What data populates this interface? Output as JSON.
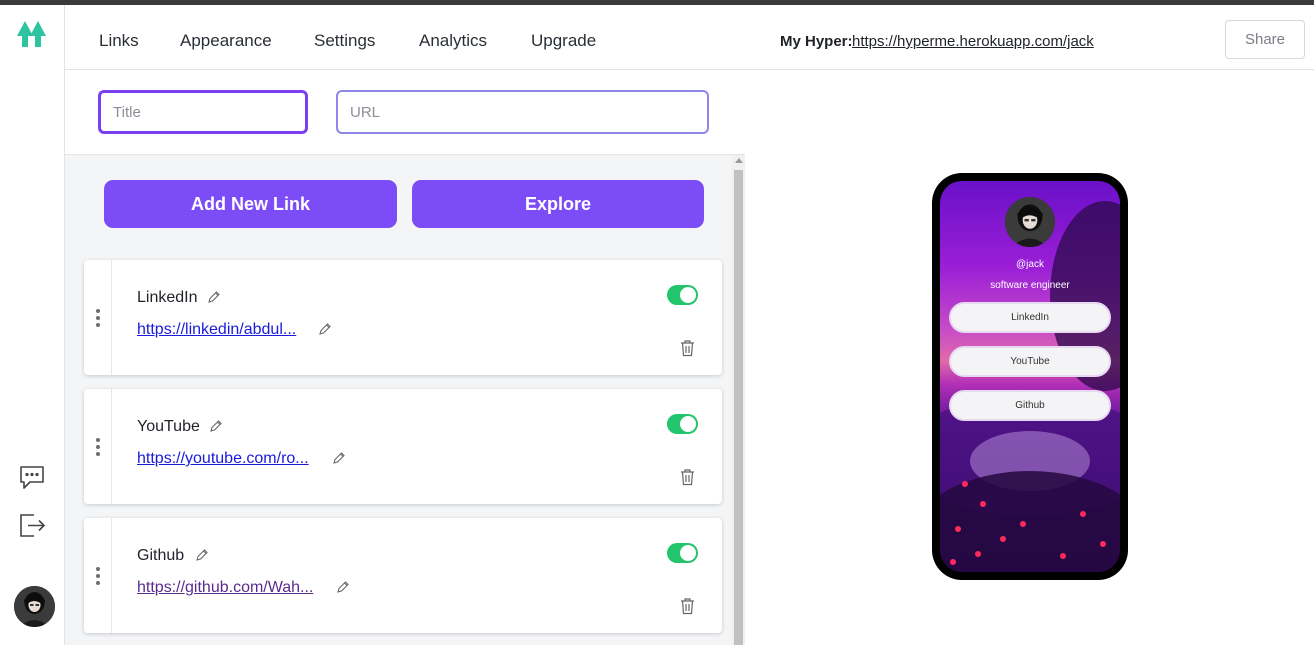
{
  "nav": {
    "items": [
      "Links",
      "Appearance",
      "Settings",
      "Analytics",
      "Upgrade"
    ]
  },
  "inputs": {
    "title_placeholder": "Title",
    "url_placeholder": "URL"
  },
  "actions": {
    "add_label": "Add New Link",
    "explore_label": "Explore"
  },
  "links": [
    {
      "title": "LinkedIn",
      "url": "https://linkedin/abdul...",
      "enabled": true
    },
    {
      "title": "YouTube",
      "url": "https://youtube.com/ro...",
      "enabled": true
    },
    {
      "title": "Github",
      "url": "https://github.com/Wah...",
      "enabled": true
    }
  ],
  "preview": {
    "label": "My Hyper:",
    "url": "https://hyperme.herokuapp.com/jack",
    "share_label": "Share",
    "handle": "@jack",
    "bio": "software engineer",
    "buttons": [
      "LinkedIn",
      "YouTube",
      "Github"
    ]
  },
  "colors": {
    "accent": "#7c4df7",
    "toggle_on": "#22c56b",
    "logo": "#2ec4a0"
  },
  "icons": {
    "logo": "tree-logo-icon",
    "chat": "chat-bubble-icon",
    "logout": "logout-icon",
    "edit": "pencil-icon",
    "delete": "trash-icon",
    "drag": "drag-handle-icon"
  }
}
